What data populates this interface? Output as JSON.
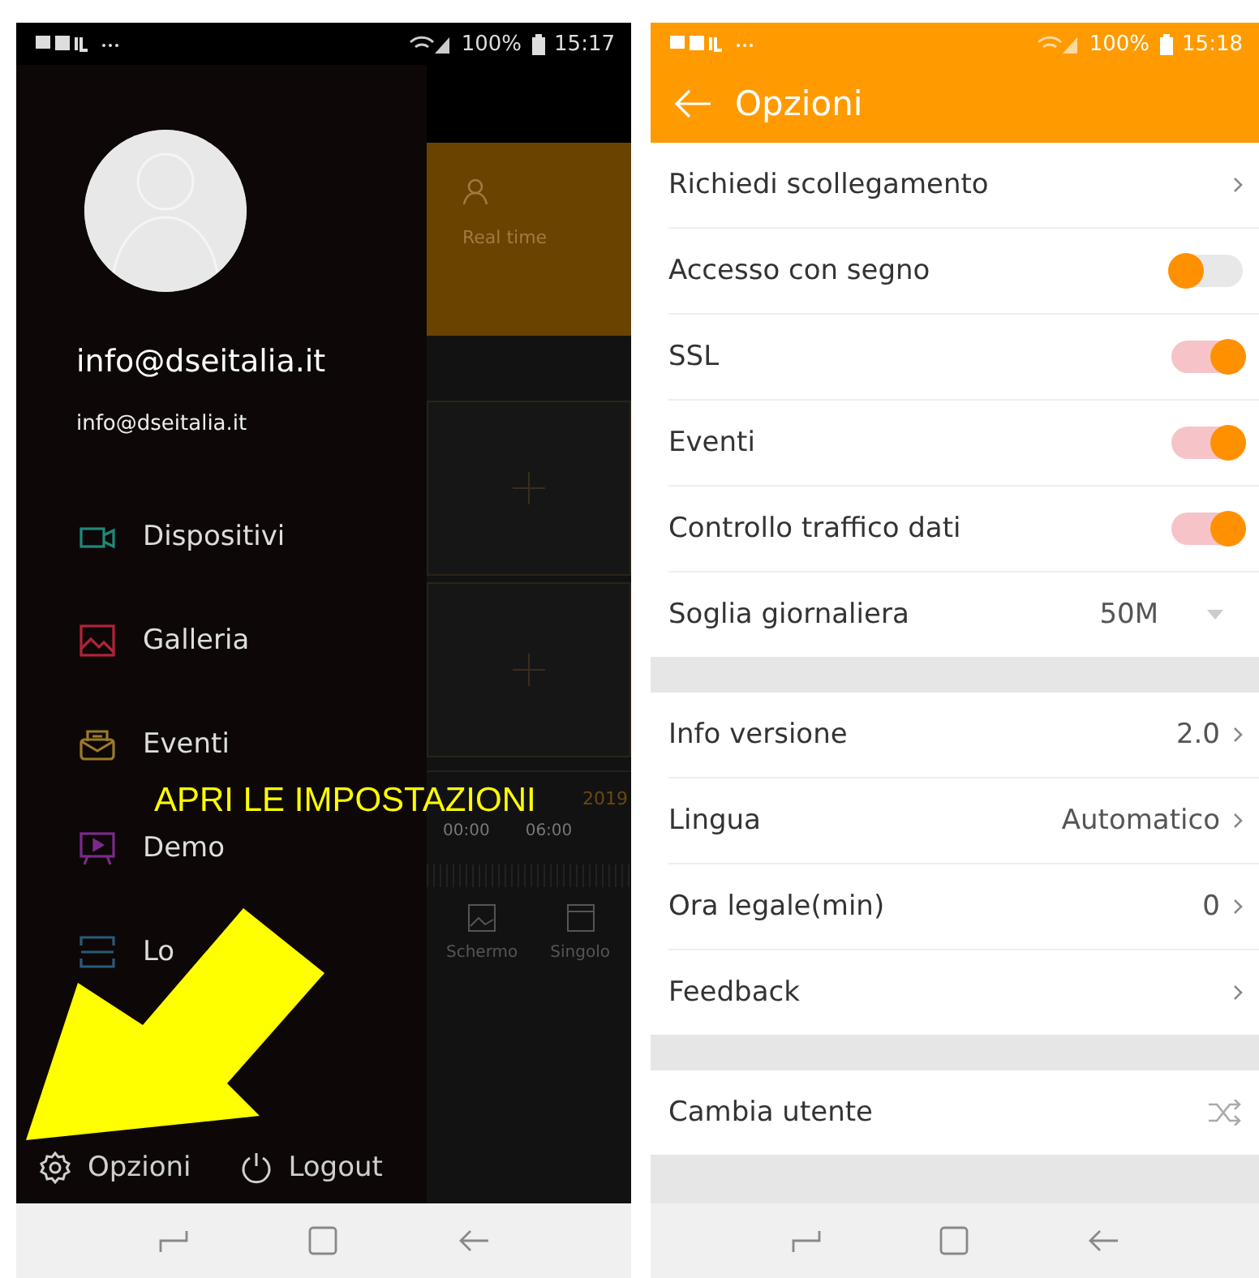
{
  "left_phone": {
    "status_bar": {
      "battery": "100%",
      "time": "15:17"
    },
    "drawer": {
      "user": {
        "name": "info@dseitalia.it",
        "email": "info@dseitalia.it"
      },
      "menu": [
        {
          "kind": "camera",
          "label": "Dispositivi",
          "color": "#1e8a78"
        },
        {
          "kind": "gallery",
          "label": "Galleria",
          "color": "#b0243a"
        },
        {
          "kind": "mail",
          "label": "Eventi",
          "color": "#9a7a2a"
        },
        {
          "kind": "presentation",
          "label": "Demo",
          "color": "#7a2a8a"
        },
        {
          "kind": "scan",
          "label": "Lo",
          "color": "#2a5a7a"
        }
      ],
      "footer": [
        {
          "kind": "settings",
          "label": "Opzioni"
        },
        {
          "kind": "power",
          "label": "Logout"
        }
      ]
    },
    "background_app": {
      "tab_label": "Real time",
      "date": "2019",
      "time_ticks": [
        "00:00",
        "06:00"
      ],
      "tools": [
        {
          "kind": "screen",
          "label": "Schermo"
        },
        {
          "kind": "single",
          "label": "Singolo"
        }
      ]
    }
  },
  "annotation": {
    "text": "APRI LE IMPOSTAZIONI"
  },
  "right_phone": {
    "status_bar": {
      "battery": "100%",
      "time": "15:18"
    },
    "title": "Opzioni",
    "sections": [
      {
        "rows": [
          {
            "kind": "link",
            "label": "Richiedi scollegamento"
          },
          {
            "kind": "toggle",
            "label": "Accesso con segno",
            "on": false
          },
          {
            "kind": "toggle",
            "label": "SSL",
            "on": true
          },
          {
            "kind": "toggle",
            "label": "Eventi",
            "on": true
          },
          {
            "kind": "toggle",
            "label": "Controllo traffico dati",
            "on": true
          },
          {
            "kind": "dropdown",
            "label": "Soglia giornaliera",
            "value": "50M"
          }
        ]
      },
      {
        "rows": [
          {
            "kind": "link",
            "label": "Info versione",
            "value": "2.0"
          },
          {
            "kind": "link",
            "label": "Lingua",
            "value": "Automatico"
          },
          {
            "kind": "link",
            "label": "Ora legale(min)",
            "value": "0"
          },
          {
            "kind": "link",
            "label": "Feedback"
          }
        ]
      },
      {
        "rows": [
          {
            "kind": "switch_user",
            "label": "Cambia utente"
          }
        ]
      }
    ]
  }
}
